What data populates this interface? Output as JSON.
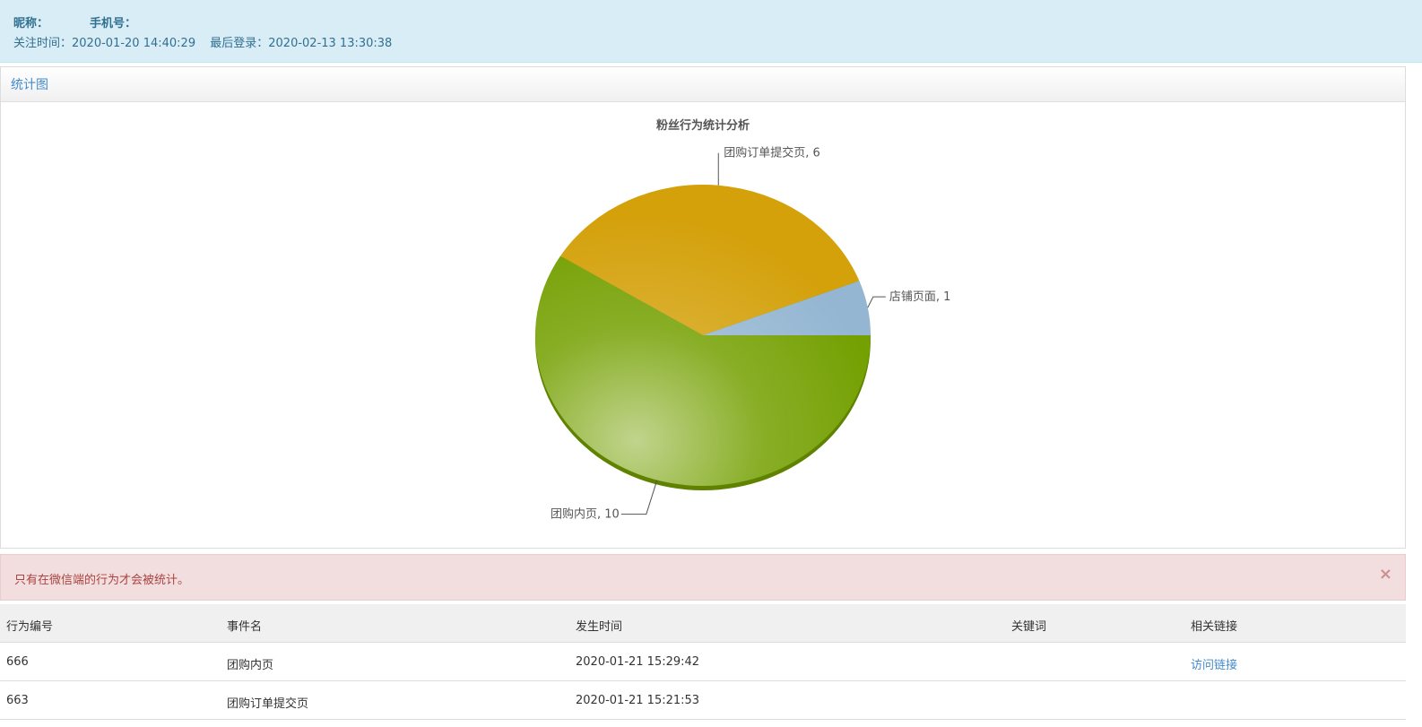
{
  "fan_info": {
    "nickname_label": "昵称：",
    "phone_label": "手机号：",
    "follow_time_label": "关注时间：",
    "follow_time": "2020-01-20 14:40:29",
    "last_login_label": "最后登录：",
    "last_login": "2020-02-13 13:30:38"
  },
  "panel": {
    "title": "统计图"
  },
  "chart_data": {
    "type": "pie",
    "title": "粉丝行为统计分析",
    "slices": [
      {
        "label": "团购内页",
        "value": 10,
        "color": "#74a001"
      },
      {
        "label": "团购订单提交页",
        "value": 6,
        "color": "#d4a10b"
      },
      {
        "label": "店铺页面",
        "value": 1,
        "color": "#94b6d2"
      }
    ]
  },
  "alert": {
    "message": "只有在微信端的行为才会被统计。",
    "close_glyph": "×"
  },
  "table": {
    "headers": [
      "行为编号",
      "事件名",
      "发生时间",
      "关键词",
      "相关链接"
    ],
    "rows": [
      {
        "id": "666",
        "event": "团购内页",
        "time": "2020-01-21 15:29:42",
        "keyword": "",
        "link": "访问链接"
      },
      {
        "id": "663",
        "event": "团购订单提交页",
        "time": "2020-01-21 15:21:53",
        "keyword": "",
        "link": ""
      }
    ]
  }
}
